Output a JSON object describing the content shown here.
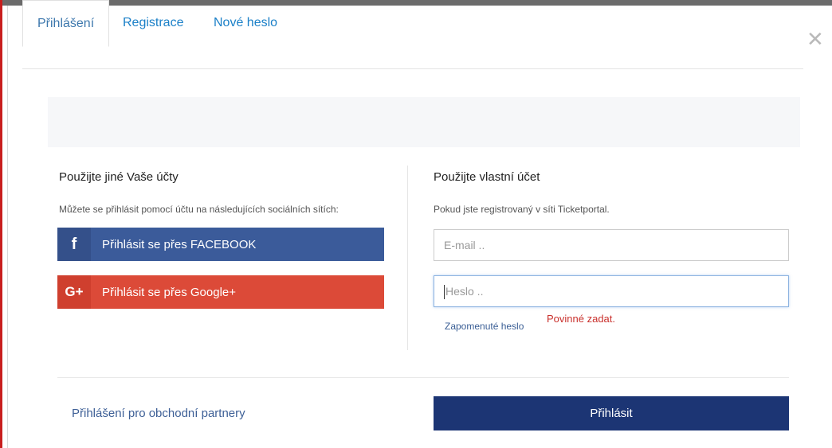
{
  "tabs": [
    {
      "label": "Přihlášení"
    },
    {
      "label": "Registrace"
    },
    {
      "label": "Nové heslo"
    }
  ],
  "close_glyph": "✕",
  "social": {
    "title": "Použijte jiné Vaše účty",
    "subtitle": "Můžete se přihlásit pomocí účtu na následujících sociálních sítích:",
    "facebook": {
      "icon": "f",
      "label": "Přihlásit se přes FACEBOOK",
      "color": "#3b5b9a"
    },
    "google": {
      "icon": "G+",
      "label": "Přihlásit se přes Google+",
      "color": "#dc4a38"
    }
  },
  "account": {
    "title": "Použijte vlastní účet",
    "subtitle": "Pokud jste registrovaný v síti Ticketportal.",
    "email_placeholder": "E-mail ..",
    "password_placeholder": "Heslo ..",
    "forgot_link": "Zapomenuté heslo",
    "error": "Povinné zadat."
  },
  "footer": {
    "partner_link": "Přihlášení pro obchodní partnery",
    "submit_label": "Přihlásit",
    "submit_color": "#1c3574"
  }
}
